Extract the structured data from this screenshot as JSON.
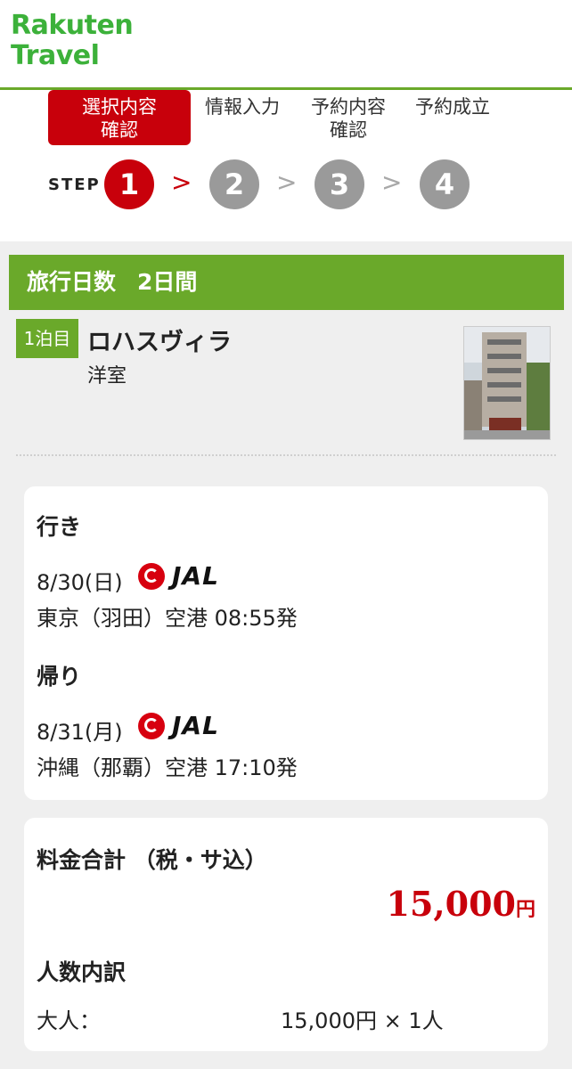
{
  "header": {
    "logo_line1": "Rakuten",
    "logo_line2": "Travel"
  },
  "steps": {
    "label_step": "STEP",
    "items": [
      {
        "label": "選択内容確認",
        "label_lines": [
          "選択内容",
          "確認"
        ],
        "number": "1",
        "active": true
      },
      {
        "label": "情報入力",
        "label_lines": [
          "情報入力"
        ],
        "number": "2",
        "active": false
      },
      {
        "label": "予約内容確認",
        "label_lines": [
          "予約内容",
          "確認"
        ],
        "number": "3",
        "active": false
      },
      {
        "label": "予約成立",
        "label_lines": [
          "予約成立"
        ],
        "number": "4",
        "active": false
      }
    ],
    "separator": ">"
  },
  "trip": {
    "title": "旅行日数",
    "days": "2日間"
  },
  "hotel": {
    "night_badge": "1泊目",
    "name": "ロハスヴィラ",
    "room_type": "洋室"
  },
  "flights": {
    "outbound": {
      "title": "行き",
      "date": "8/30(日)",
      "airline": "JAL",
      "detail": "東京（羽田）空港 08:55発"
    },
    "return": {
      "title": "帰り",
      "date": "8/31(月)",
      "airline": "JAL",
      "detail": "沖縄（那覇）空港 17:10発"
    }
  },
  "price": {
    "title": "料金合計 （税・サ込）",
    "amount": "15,000",
    "currency": "円",
    "breakdown_title": "人数内訳",
    "adult_label": "大人：",
    "adult_price": "15,000円 × 1人"
  },
  "colors": {
    "brand_green": "#6aa92a",
    "logo_green": "#3cb13a",
    "accent_red": "#c8000b",
    "inactive_gray": "#9a9a9a"
  }
}
